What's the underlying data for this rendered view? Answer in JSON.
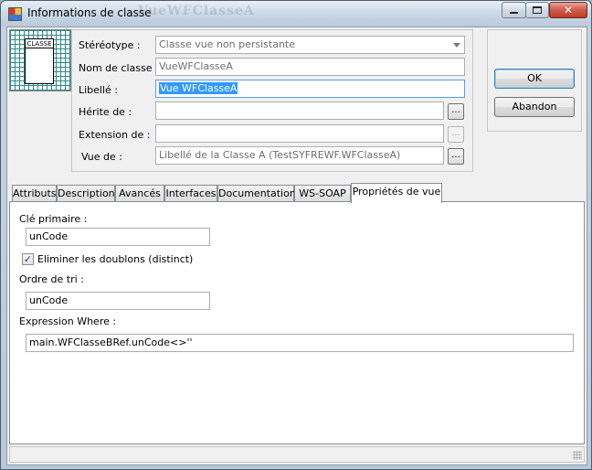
{
  "window": {
    "title": "Informations de classe",
    "background_title": "VueWFClasseA"
  },
  "icon": {
    "label": "CLASSE"
  },
  "form": {
    "stereotype_label": "Stéréotype :",
    "stereotype_value": "Classe vue non persistante",
    "class_name_label": "Nom de classe :",
    "class_name_value": "VueWFClasseA",
    "libelle_label": "Libellé :",
    "libelle_value": "Vue WFClasseA",
    "herite_label": "Hérite de :",
    "herite_value": "",
    "extension_label": "Extension de :",
    "extension_value": "",
    "vue_label": "Vue de :",
    "vue_value": "Libellé de la Classe A (TestSYFREWF.WFClasseA)",
    "browse_label": "..."
  },
  "buttons": {
    "ok": "OK",
    "abandon": "Abandon"
  },
  "tabs": [
    {
      "label": "Attributs"
    },
    {
      "label": "Description"
    },
    {
      "label": "Avancés"
    },
    {
      "label": "Interfaces"
    },
    {
      "label": "Documentation"
    },
    {
      "label": "WS-SOAP"
    },
    {
      "label": "Propriétés de vue"
    }
  ],
  "vue_props": {
    "primary_key_label": "Clé primaire :",
    "primary_key_value": "unCode",
    "distinct_label": "Eliminer les doublons (distinct)",
    "distinct_checked": true,
    "sort_label": "Ordre de tri :",
    "sort_value": "unCode",
    "where_label": "Expression Where :",
    "where_value": "main.WFClasseBRef.unCode<>''"
  },
  "glyphs": {
    "close": "✕",
    "check": "✓"
  }
}
